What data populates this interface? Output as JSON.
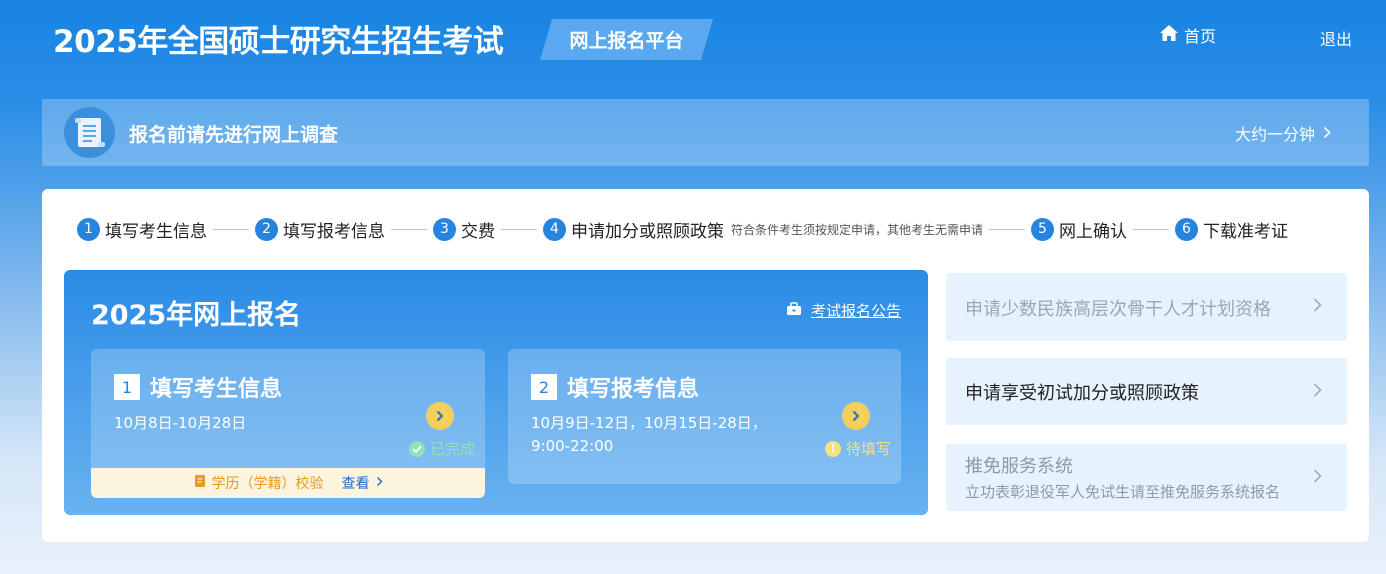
{
  "header": {
    "title": "2025年全国硕士研究生招生考试",
    "platform": "网上报名平台",
    "home_label": "首页",
    "logout_label": "退出"
  },
  "survey": {
    "text": "报名前请先进行网上调查",
    "time": "大约一分钟"
  },
  "steps": [
    {
      "num": "1",
      "label": "填写考生信息"
    },
    {
      "num": "2",
      "label": "填写报考信息"
    },
    {
      "num": "3",
      "label": "交费"
    },
    {
      "num": "4",
      "label": "申请加分或照顾政策",
      "note": "符合条件考生须按规定申请，其他考生无需申请"
    },
    {
      "num": "5",
      "label": "网上确认"
    },
    {
      "num": "6",
      "label": "下载准考证"
    }
  ],
  "registration": {
    "title": "2025年网上报名",
    "notice": "考试报名公告",
    "cards": [
      {
        "num": "1",
        "title": "填写考生信息",
        "dates": "10月8日-10月28日",
        "status": "已完成"
      },
      {
        "num": "2",
        "title": "填写报考信息",
        "dates_line1": "10月9日-12日，10月15日-28日，",
        "dates_line2": "9:00-22:00",
        "status": "待填写"
      }
    ],
    "verify": {
      "label": "学历（学籍）校验",
      "view": "查看"
    }
  },
  "side": [
    {
      "label": "申请少数民族高层次骨干人才计划资格"
    },
    {
      "label": "申请享受初试加分或照顾政策"
    },
    {
      "label": "推免服务系统",
      "sub": "立功表彰退役军人免试生请至推免服务系统报名"
    }
  ],
  "colors": {
    "primary": "#2683de",
    "accent_yellow": "#f5cf5b",
    "done_green": "#8fe3b7",
    "side_bg": "#e6f2fd"
  }
}
